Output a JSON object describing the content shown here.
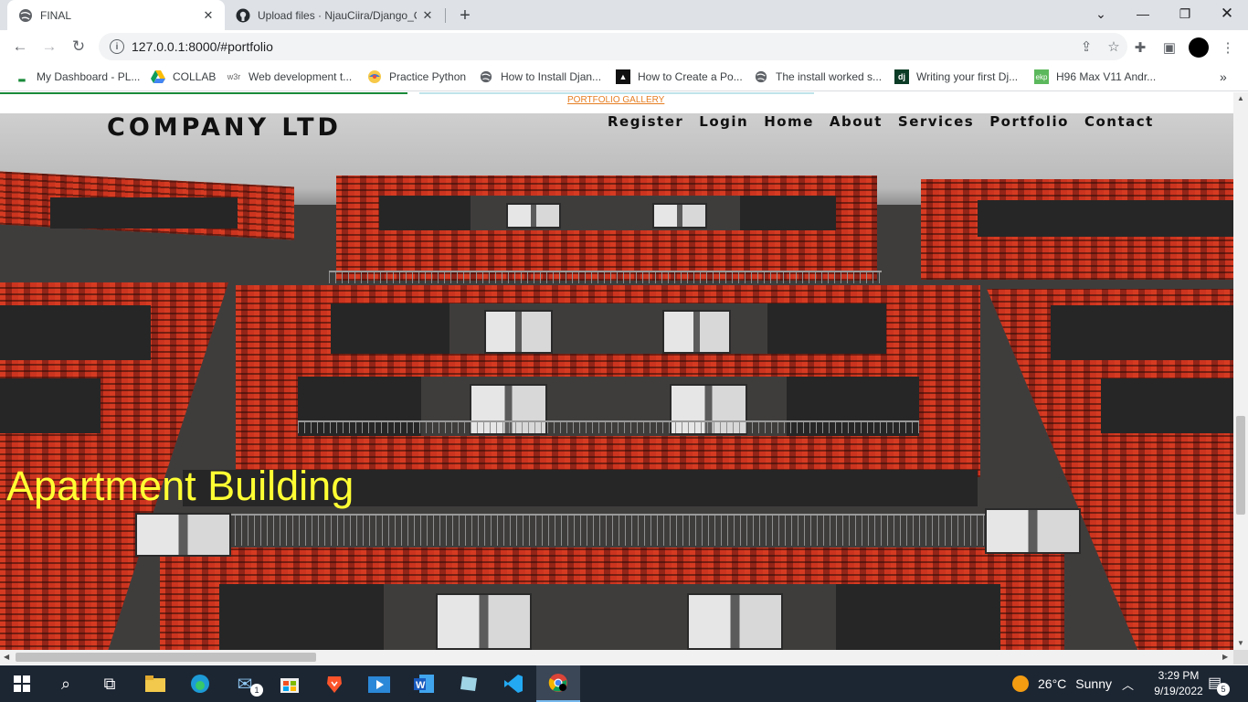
{
  "tabs": [
    {
      "title": "FINAL",
      "active": true
    },
    {
      "title": "Upload files · NjauCiira/Django_C",
      "active": false
    }
  ],
  "toolbar": {
    "url": "127.0.0.1:8000/#portfolio"
  },
  "bookmarks": [
    {
      "label": "My Dashboard - PL...",
      "icon": "dash-icon"
    },
    {
      "label": "COLLAB",
      "icon": "drive-icon"
    },
    {
      "label": "Web development t...",
      "icon": "w3-icon"
    },
    {
      "label": "Practice Python",
      "icon": "python-icon"
    },
    {
      "label": "How to Install Djan...",
      "icon": "globe-icon"
    },
    {
      "label": "How to Create a Po...",
      "icon": "medium-icon"
    },
    {
      "label": "The install worked s...",
      "icon": "globe-icon"
    },
    {
      "label": "Writing your first Dj...",
      "icon": "django-icon"
    },
    {
      "label": "H96 Max V11 Andr...",
      "icon": "ekp-icon"
    }
  ],
  "page": {
    "gallery_link": "PORTFOLIO GALLERY",
    "brand": "COMPANY LTD",
    "nav": [
      "Register",
      "Login",
      "Home",
      "About",
      "Services",
      "Portfolio",
      "Contact"
    ],
    "caption": "Apartment Building"
  },
  "taskbar": {
    "weather_temp": "26°C",
    "weather_desc": "Sunny",
    "time": "3:29 PM",
    "date": "9/19/2022",
    "notification_count": "5",
    "mail_badge": "1"
  }
}
